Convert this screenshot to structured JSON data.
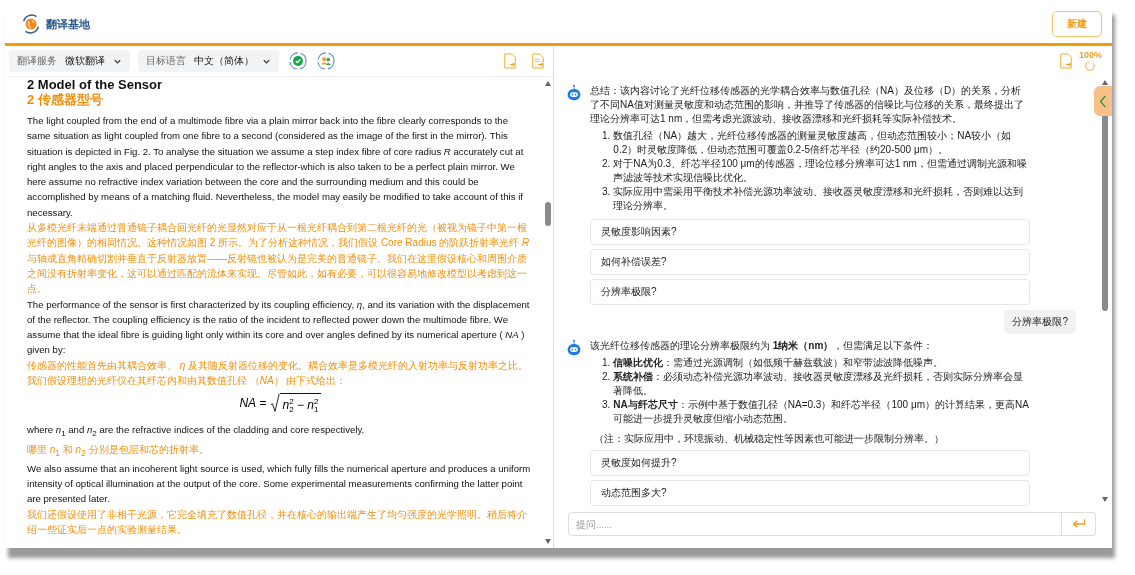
{
  "app": {
    "title": "翻译基地",
    "new_button": "新建"
  },
  "toolbar": {
    "selects": [
      {
        "label": "翻译服务",
        "value": "微软翻译"
      },
      {
        "label": "目标语言",
        "value": "中文（简体）"
      }
    ]
  },
  "document": {
    "blocks": [
      {
        "kind": "heading",
        "translated": false,
        "text": "2 Model of the Sensor"
      },
      {
        "kind": "heading",
        "translated": true,
        "text": "2 传感器型号"
      },
      {
        "kind": "paragraph",
        "translated": false,
        "text": "The light coupled from the end of a multimode fibre via a plain mirror back into the fibre clearly corresponds to the same situation as light coupled from one fibre to a second (considered as the image of the first in the mirror). This situation is depicted in Fig. 2. To analyse the situation we assume a step index fibre of core radius *R* accurately cut at right angles to the axis and placed perpendicular to the reflector-which is also taken to be a perfect plain mirror. We here assume no refractive index variation between the core and the surrounding medium and this could be accomplished by means of a matching fluid. Nevertheless, the model may easily be modified to take account of this if necessary."
      },
      {
        "kind": "paragraph",
        "translated": true,
        "text": "从多模光纤末端通过普通镜子耦合回光纤的光显然对应于从一根光纤耦合到第二根光纤的光（被视为镜子中第一根光纤的图像）的相同情况。这种情况如图 2 所示。为了分析这种情况，我们假设 Core Radius 的阶跃折射率光纤 *R* 与轴成直角精确切割并垂直于反射器放置——反射镜也被认为是完美的普通镜子。我们在这里假设核心和周围介质之间没有折射率变化，这可以通过匹配的流体来实现。尽管如此，如有必要，可以很容易地修改模型以考虑到这一点。"
      },
      {
        "kind": "paragraph",
        "translated": false,
        "text": "The performance of the sensor is first characterized by its coupling efficiency, *η*, and its variation with the displacement of the reflector. The coupling efficiency is the ratio of the incident to reflected power down the multimode fibre. We assume that the ideal fibre is guiding light only within its core and over angles defined by its numerical aperture ( *NA* ) given by:"
      },
      {
        "kind": "paragraph",
        "translated": true,
        "text": "传感器的性能首先由其耦合效率、 *η* 及其随反射器位移的变化。耦合效率是多模光纤的入射功率与反射功率之比。我们假设理想的光纤仅在其纤芯内和由其数值孔径 （*NA*） 由下式给出："
      },
      {
        "kind": "formula",
        "lhs": "*NA* =",
        "radicand": "*n*$^{2}$$_{2}$ − *n*$^{2}$$_{1}$"
      },
      {
        "kind": "paragraph",
        "translated": false,
        "text": "where *n*$_{1}$ and *n*$_{2}$ are the refractive indices of the cladding and core respectively."
      },
      {
        "kind": "paragraph",
        "translated": true,
        "text": "哪里 *n*$_{1}$ 和 *n*$_{2}$ 分别是包层和芯的折射率。"
      },
      {
        "kind": "paragraph",
        "translated": false,
        "text": "We also assume that an incoherent light source is used, which fully fills the numerical aperture and produces a uniform intensity of optical illumination at the output of the core. Some experimental measurements confirming the latter point are presented later."
      },
      {
        "kind": "paragraph",
        "translated": true,
        "text": "我们还假设使用了非相干光源，它完全填充了数值孔径，并在核心的输出端产生了均匀强度的光学照明。稍后将介绍一些证实后一点的实验测量结果。"
      }
    ]
  },
  "chat": {
    "zoom": "100%",
    "messages": [
      {
        "kind": "bot",
        "text": "总结：该内容讨论了光纤位移传感器的光学耦合效率与数值孔径（NA）及位移（D）的关系，分析了不同NA值对测量灵敏度和动态范围的影响，并推导了传感器的信噪比与位移的关系，最终提出了理论分辨率可达1 nm，但需考虑光源波动、接收器漂移和光纤损耗等实际补偿技术。",
        "list": [
          {
            "number": "1.",
            "text": "数值孔径（NA）越大，光纤位移传感器的测量灵敏度越高，但动态范围较小；NA较小（如0.2）时灵敏度降低，但动态范围可覆盖0.2-5倍纤芯半径（约20-500 μm）。"
          },
          {
            "number": "2.",
            "text": "对于NA为0.3、纤芯半径100 μm的传感器，理论位移分辨率可达1 nm，但需通过调制光源和噪声滤波等技术实现信噪比优化。"
          },
          {
            "number": "3.",
            "text": "实际应用中需采用平衡技术补偿光源功率波动、接收器灵敏度漂移和光纤损耗，否则难以达到理论分辨率。"
          }
        ],
        "suggestions": [
          "灵敏度影响因素?",
          "如何补偿误差?",
          "分辨率极限?"
        ]
      },
      {
        "kind": "user",
        "text": "分辨率极限?"
      },
      {
        "kind": "bot",
        "text": "该光纤位移传感器的理论分辨率极限约为 **1纳米（nm）**，但需满足以下条件：",
        "list": [
          {
            "number": "1.",
            "text": "**信噪比优化**：需通过光源调制（如低频千赫兹载波）和窄带滤波降低噪声。"
          },
          {
            "number": "2.",
            "text": "**系统补偿**：必须动态补偿光源功率波动、接收器灵敏度漂移及光纤损耗，否则实际分辨率会显著降低。"
          },
          {
            "number": "3.",
            "text": "**NA与纤芯尺寸**：示例中基于数值孔径（NA=0.3）和纤芯半径（100 μm）的计算结果，更高NA可能进一步提升灵敏度但缩小动态范围。"
          }
        ],
        "note": "（注：实际应用中，环境振动、机械稳定性等因素也可能进一步限制分辨率。）",
        "suggestions": [
          "灵敏度如何提升?",
          "动态范围多大?"
        ]
      }
    ],
    "input": {
      "placeholder": "提问......"
    }
  }
}
